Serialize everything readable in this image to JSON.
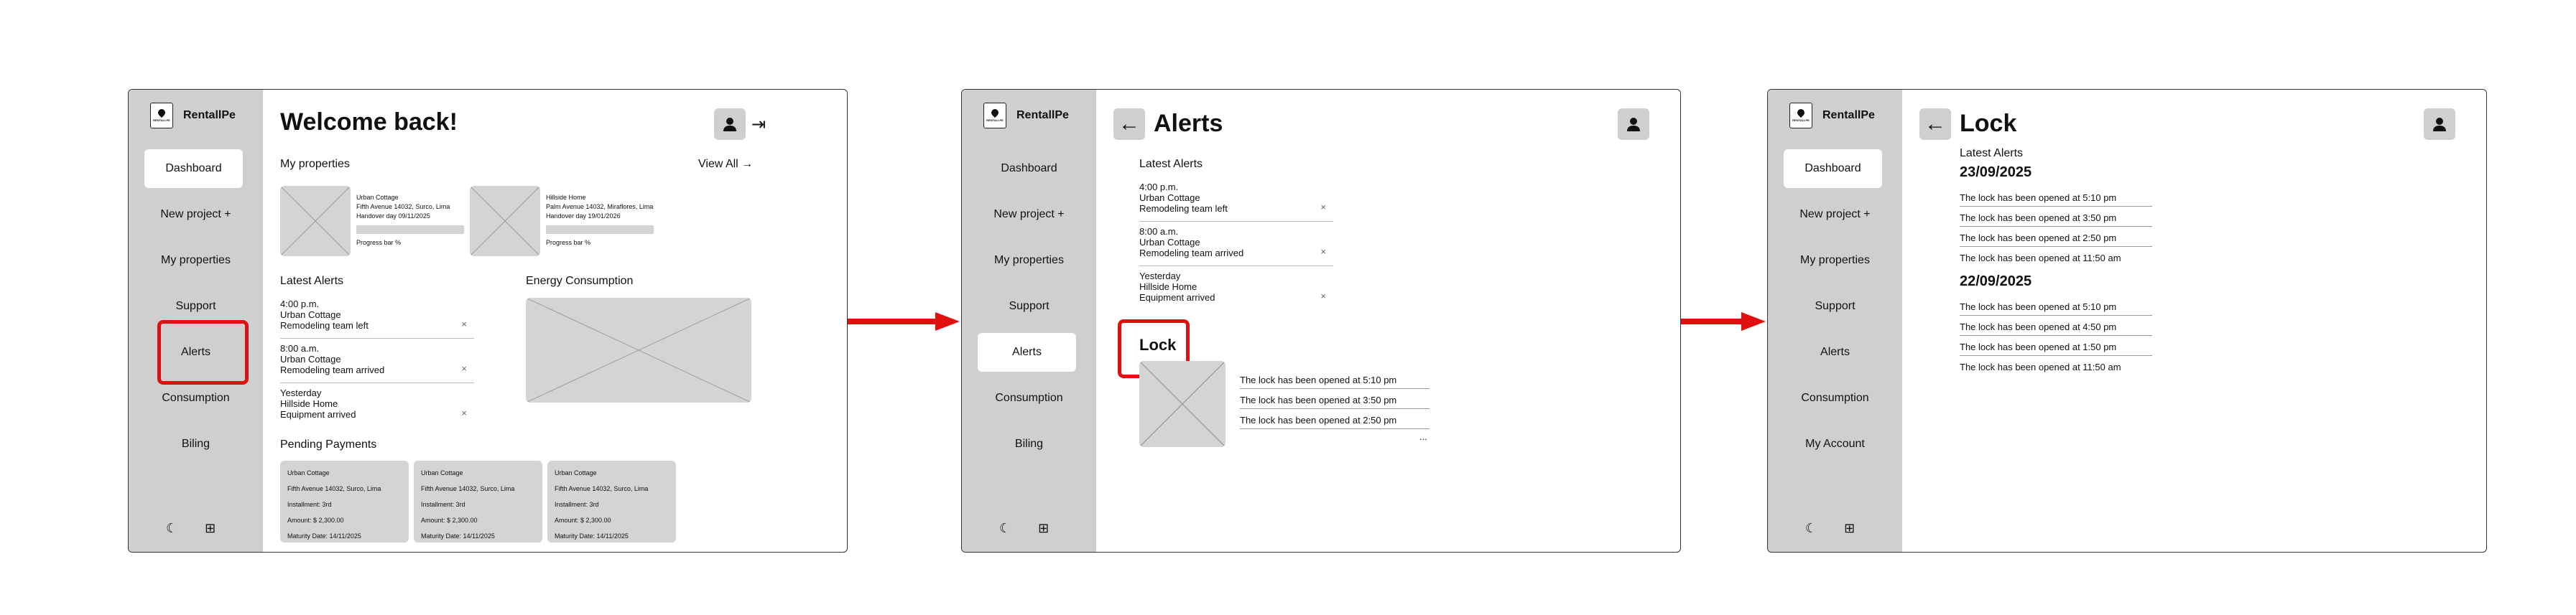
{
  "brand": "RentallPe",
  "brand_mini": "RENTALLPE",
  "colors": {
    "accent": "#e01010",
    "sidebar": "#cfcfcf",
    "placeholder": "#d4d4d4"
  },
  "nav1": [
    "Dashboard",
    "New project +",
    "My properties",
    "Support",
    "Alerts",
    "Consumption",
    "Biling"
  ],
  "nav2": [
    "Dashboard",
    "New project +",
    "My properties",
    "Support",
    "Alerts",
    "Consumption",
    "Biling"
  ],
  "nav3": [
    "Dashboard",
    "New project +",
    "My properties",
    "Support",
    "Alerts",
    "Consumption",
    "My Account"
  ],
  "s1": {
    "title": "Welcome back!",
    "my_properties": "My properties",
    "view_all": "View All →",
    "prop1": {
      "name": "Urban Cottage",
      "address": "Fifth Avenue 14032, Surco, Lima",
      "handover": "Handover day 09/11/2025",
      "progress": "Progress bar %"
    },
    "prop2": {
      "name": "Hillside Home",
      "address": "Palm Avenue 14032, Miraflores, Lima",
      "handover": "Handover day 19/01/2026",
      "progress": "Progress bar %"
    },
    "latest_alerts": "Latest Alerts",
    "energy": "Energy Consumption",
    "pending": "Pending Payments",
    "payments": [
      {
        "name": "Urban Cottage",
        "address": "Fifth Avenue 14032, Surco, Lima",
        "installment": "Installment: 3rd",
        "amount": "Amount: $ 2,300.00",
        "maturity": "Maturity Date:  14/11/2025"
      },
      {
        "name": "Urban Cottage",
        "address": "Fifth Avenue 14032, Surco, Lima",
        "installment": "Installment: 3rd",
        "amount": "Amount: $ 2,300.00",
        "maturity": "Maturity Date:  14/11/2025"
      },
      {
        "name": "Urban Cottage",
        "address": "Fifth Avenue 14032, Surco, Lima",
        "installment": "Installment: 3rd",
        "amount": "Amount: $ 2,300.00",
        "maturity": "Maturity Date:  14/11/2025"
      }
    ]
  },
  "alerts": [
    {
      "time": "4:00 p.m.",
      "place": "Urban Cottage",
      "text": "Remodeling team left"
    },
    {
      "time": "8:00 a.m.",
      "place": "Urban Cottage",
      "text": "Remodeling team arrived"
    },
    {
      "time": "Yesterday",
      "place": "Hillside Home",
      "text": "Equipment arrived"
    }
  ],
  "dismiss_glyph": "×",
  "s2": {
    "title": "Alerts",
    "latest_alerts": "Latest Alerts",
    "lock": "Lock",
    "lock_events": [
      "The lock has been opened at 5:10 pm",
      "The lock has been opened at 3:50 pm",
      "The lock has been opened at 2:50 pm"
    ],
    "more": "..."
  },
  "s3": {
    "title": "Lock",
    "latest_alerts": "Latest Alerts",
    "day1": "23/09/2025",
    "day1_events": [
      "The lock has been opened at 5:10 pm",
      "The lock has been opened at 3:50 pm",
      "The lock has been opened at 2:50 pm",
      "The lock has been opened at 11:50 am"
    ],
    "day2": "22/09/2025",
    "day2_events": [
      "The lock has been opened at 5:10 pm",
      "The lock has been opened at 4:50 pm",
      "The lock has been opened at 1:50 pm",
      "The lock has been opened at 11:50 am"
    ]
  }
}
